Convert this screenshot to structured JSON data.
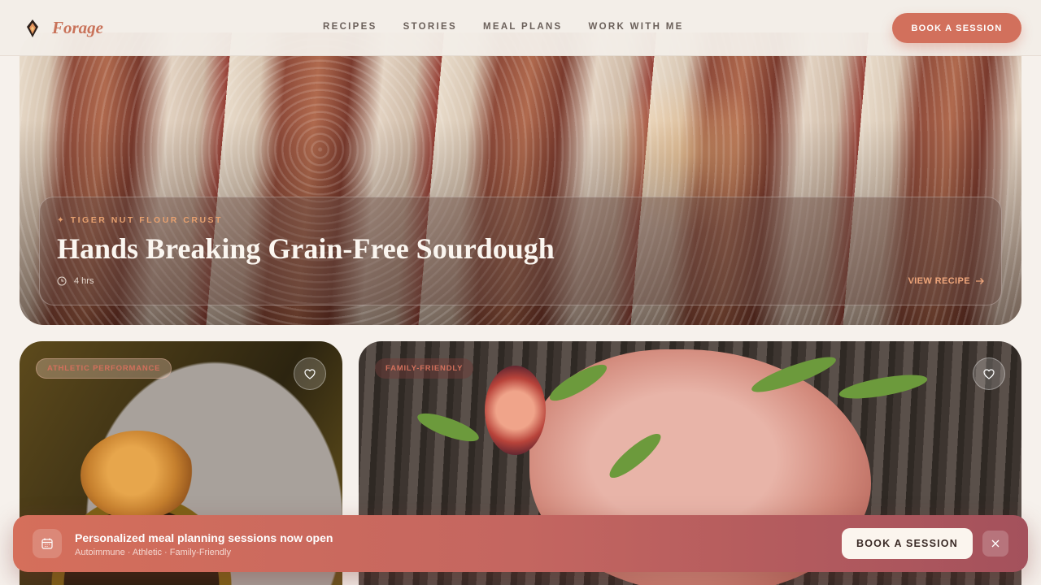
{
  "header": {
    "brand": "Forage",
    "logo_icon": "diamond-flame-logo",
    "nav": [
      "RECIPES",
      "STORIES",
      "MEAL PLANS",
      "WORK WITH ME"
    ],
    "cta_label": "BOOK A SESSION"
  },
  "hero": {
    "tag": "✦ TIGER NUT FLOUR CRUST",
    "title": "Hands Breaking Grain-Free Sourdough",
    "time": "4 hrs",
    "time_icon": "clock-icon",
    "link_label": "VIEW RECIPE",
    "link_icon": "arrow-right-icon"
  },
  "cards": [
    {
      "tag": "ATHLETIC PERFORMANCE",
      "fav_icon": "heart-icon"
    },
    {
      "tag": "FAMILY-FRIENDLY",
      "fav_icon": "heart-icon"
    }
  ],
  "banner": {
    "icon": "calendar-icon",
    "title": "Personalized meal planning sessions now open",
    "subtitle": "Autoimmune · Athletic · Family-Friendly",
    "cta_label": "BOOK A SESSION",
    "close_icon": "close-icon"
  },
  "colors": {
    "accent": "#d2705c",
    "brand_text": "#c9735a",
    "tag_orange": "#e6a06f",
    "background": "#f6f1ec"
  }
}
